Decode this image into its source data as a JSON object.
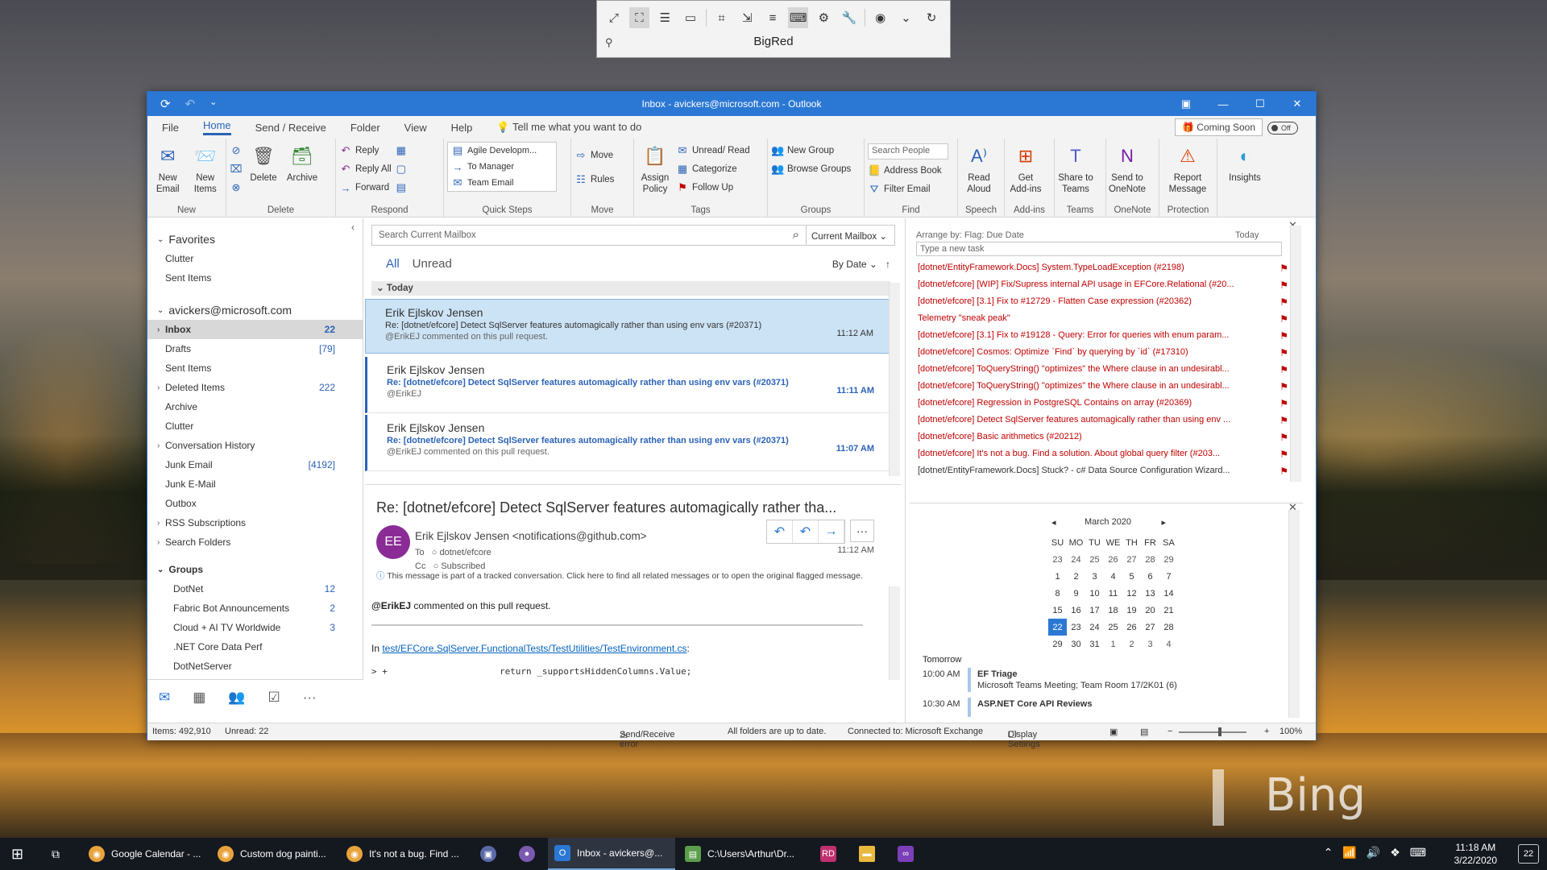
{
  "remote_bar": {
    "name": "BigRed",
    "icons": [
      "fit-icon",
      "fullscreen-icon",
      "menu-icon",
      "window-icon",
      "focus-icon",
      "expand-icon",
      "list-icon",
      "keyboard-icon",
      "settings-icon",
      "wrench-icon",
      "camera-icon",
      "chevron-down-icon",
      "disconnect-icon"
    ]
  },
  "window": {
    "title": "Inbox - avickers@microsoft.com - Outlook"
  },
  "menu": {
    "tabs": [
      "File",
      "Home",
      "Send / Receive",
      "Folder",
      "View",
      "Help"
    ],
    "tell_me": "Tell me what you want to do",
    "coming_soon": "Coming Soon",
    "toggle": "Off"
  },
  "ribbon": {
    "new_email": "New Email",
    "new_items": "New Items",
    "group_new": "New",
    "delete": "Delete",
    "archive": "Archive",
    "group_delete": "Delete",
    "reply": "Reply",
    "reply_all": "Reply All",
    "forward": "Forward",
    "group_respond": "Respond",
    "quick_steps": [
      "Agile Developm...",
      "To Manager",
      "Team Email"
    ],
    "group_quick_steps": "Quick Steps",
    "move": "Move",
    "rules": "Rules",
    "group_move": "Move",
    "assign_policy": "Assign Policy",
    "unread_read": "Unread/ Read",
    "categorize": "Categorize",
    "follow_up": "Follow Up",
    "group_tags": "Tags",
    "new_group": "New Group",
    "browse_groups": "Browse Groups",
    "group_groups": "Groups",
    "search_people": "Search People",
    "address_book": "Address Book",
    "filter_email": "Filter Email",
    "group_find": "Find",
    "read_aloud": "Read Aloud",
    "group_speech": "Speech",
    "get_addins": "Get Add-ins",
    "group_addins": "Add-ins",
    "share_teams": "Share to Teams",
    "group_teams": "Teams",
    "send_onenote": "Send to OneNote",
    "group_onenote": "OneNote",
    "report_message": "Report Message",
    "group_protection": "Protection",
    "insights": "Insights"
  },
  "folders": {
    "favorites_label": "Favorites",
    "favorites": [
      {
        "label": "Clutter",
        "count": ""
      },
      {
        "label": "Sent Items",
        "count": ""
      }
    ],
    "account": "avickers@microsoft.com",
    "items": [
      {
        "label": "Inbox",
        "count": "22",
        "arrow": "›"
      },
      {
        "label": "Drafts",
        "count": "[79]",
        "arrow": ""
      },
      {
        "label": "Sent Items",
        "count": "",
        "arrow": ""
      },
      {
        "label": "Deleted Items",
        "count": "222",
        "arrow": "›"
      },
      {
        "label": "Archive",
        "count": "",
        "arrow": ""
      },
      {
        "label": "Clutter",
        "count": "",
        "arrow": ""
      },
      {
        "label": "Conversation History",
        "count": "",
        "arrow": "›"
      },
      {
        "label": "Junk Email",
        "count": "[4192]",
        "arrow": ""
      },
      {
        "label": "Junk E-Mail",
        "count": "",
        "arrow": ""
      },
      {
        "label": "Outbox",
        "count": "",
        "arrow": ""
      },
      {
        "label": "RSS Subscriptions",
        "count": "",
        "arrow": "›"
      },
      {
        "label": "Search Folders",
        "count": "",
        "arrow": "›"
      }
    ],
    "groups_label": "Groups",
    "groups": [
      {
        "label": "DotNet",
        "count": "12"
      },
      {
        "label": "Fabric Bot Announcements",
        "count": "2"
      },
      {
        "label": "Cloud + AI TV Worldwide",
        "count": "3"
      },
      {
        "label": ".NET Core Data Perf",
        "count": ""
      },
      {
        "label": "DotNetServer",
        "count": ""
      }
    ]
  },
  "message_list": {
    "search_placeholder": "Search Current Mailbox",
    "scope": "Current Mailbox",
    "filter_all": "All",
    "filter_unread": "Unread",
    "sort": "By Date",
    "group_header": "Today",
    "messages": [
      {
        "from": "Erik Ejlskov Jensen",
        "subject": "Re: [dotnet/efcore] Detect SqlServer features automagically rather than using env vars (#20371)",
        "preview": "@ErikEJ commented on this pull request.",
        "time": "11:12 AM"
      },
      {
        "from": "Erik Ejlskov Jensen",
        "subject": "Re: [dotnet/efcore] Detect SqlServer features automagically rather than using env vars (#20371)",
        "preview": "@ErikEJ",
        "time": "11:11 AM"
      },
      {
        "from": "Erik Ejlskov Jensen",
        "subject": "Re: [dotnet/efcore] Detect SqlServer features automagically rather than using env vars (#20371)",
        "preview": "@ErikEJ commented on this pull request.",
        "time": "11:07 AM"
      }
    ]
  },
  "reading": {
    "subject": "Re: [dotnet/efcore] Detect SqlServer features automagically rather tha...",
    "avatar": "EE",
    "from": "Erik Ejlskov Jensen <notifications@github.com>",
    "to_label": "To",
    "to": "dotnet/efcore",
    "cc_label": "Cc",
    "cc": "Subscribed",
    "time": "11:12 AM",
    "info": "This message is part of a tracked conversation. Click here to find all related messages or to open the original flagged message.",
    "body_mention": "@ErikEJ",
    "body_text": " commented on this pull request.",
    "in_label": "In ",
    "link": "test/EFCore.SqlServer.FunctionalTests/TestUtilities/TestEnvironment.cs",
    "link_suffix": ":",
    "code": "> +                     return _supportsHiddenColumns.Value;"
  },
  "todo": {
    "arrange": "Arrange by: Flag: Due Date",
    "today": "Today",
    "new_task": "Type a new task",
    "tasks": [
      "[dotnet/EntityFramework.Docs] System.TypeLoadException (#2198)",
      "[dotnet/efcore] [WIP] Fix/Supress internal API usage in EFCore.Relational (#20...",
      "[dotnet/efcore] [3.1] Fix to #12729 - Flatten Case expression (#20362)",
      "Telemetry \"sneak peak\"",
      "[dotnet/efcore] [3.1] Fix to #19128 - Query: Error for queries with enum param...",
      "[dotnet/efcore] Cosmos: Optimize `Find` by querying by `id` (#17310)",
      "[dotnet/efcore] ToQueryString() \"optimizes\" the Where clause in an undesirabl...",
      "[dotnet/efcore] ToQueryString() \"optimizes\" the Where clause in an undesirabl...",
      "[dotnet/efcore] Regression in PostgreSQL Contains on array (#20369)",
      "[dotnet/efcore] Detect SqlServer features automagically rather than using env ...",
      "[dotnet/efcore] Basic arithmetics (#20212)",
      "[dotnet/efcore] It's not a bug. Find a solution. About global query filter (#203...",
      "[dotnet/EntityFramework.Docs] Stuck? - c# Data Source Configuration Wizard..."
    ]
  },
  "calendar": {
    "month": "March 2020",
    "weekdays": [
      "SU",
      "MO",
      "TU",
      "WE",
      "TH",
      "FR",
      "SA"
    ],
    "weeks": [
      [
        "23",
        "24",
        "25",
        "26",
        "27",
        "28",
        "29"
      ],
      [
        "1",
        "2",
        "3",
        "4",
        "5",
        "6",
        "7"
      ],
      [
        "8",
        "9",
        "10",
        "11",
        "12",
        "13",
        "14"
      ],
      [
        "15",
        "16",
        "17",
        "18",
        "19",
        "20",
        "21"
      ],
      [
        "22",
        "23",
        "24",
        "25",
        "26",
        "27",
        "28"
      ],
      [
        "29",
        "30",
        "31",
        "1",
        "2",
        "3",
        "4"
      ]
    ],
    "selected": "22",
    "tomorrow": "Tomorrow",
    "appointments": [
      {
        "time": "10:00 AM",
        "name": "EF Triage",
        "location": "Microsoft Teams Meeting; Team Room 17/2K01 (6)"
      },
      {
        "time": "10:30 AM",
        "name": "ASP.NET Core API Reviews",
        "location": ""
      }
    ]
  },
  "status": {
    "items": "Items: 492,910",
    "unread": "Unread: 22",
    "error": "Send/Receive error",
    "uptodate": "All folders are up to date.",
    "connected": "Connected to: Microsoft Exchange",
    "display": "Display Settings",
    "zoom": "100%"
  },
  "taskbar": {
    "apps": [
      {
        "label": "Google Calendar - ...",
        "color": "#e8a33d"
      },
      {
        "label": "Custom dog painti...",
        "color": "#e8a33d"
      },
      {
        "label": "It's not a bug. Find ...",
        "color": "#e8a33d"
      },
      {
        "label": "Inbox - avickers@...",
        "color": "#2b78d4"
      },
      {
        "label": "C:\\Users\\Arthur\\Dr...",
        "color": "#5a9e4b"
      }
    ],
    "time": "11:18 AM",
    "date": "3/22/2020",
    "notifications": "22"
  }
}
